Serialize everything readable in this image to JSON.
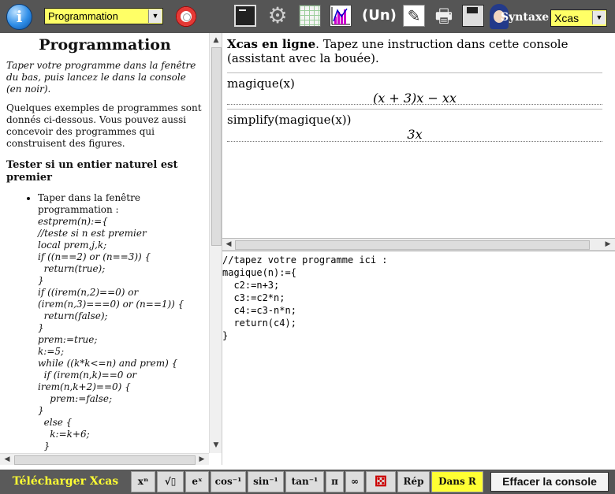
{
  "toolbar": {
    "info_glyph": "i",
    "mode_value": "Programmation",
    "sequence_label": "(Un)",
    "syntax_label": "Syntaxe",
    "syntax_value": "Xcas",
    "icons": [
      "info-icon",
      "lifebuoy-icon",
      "console-icon",
      "settings-icon",
      "spreadsheet-icon",
      "graph-icon",
      "sequence-icon",
      "pencil-icon",
      "printer-icon",
      "save-icon",
      "avatar-icon"
    ]
  },
  "left": {
    "title": "Programmation",
    "intro": "Taper votre programme dans la fenêtre du bas, puis lancez le dans la console (en noir).",
    "examples": "Quelques exemples de programmes sont donnés ci-dessous. Vous pouvez aussi concevoir des programmes qui construisent des figures.",
    "section_heading": "Tester si un entier naturel est premier",
    "list_item_text": "Taper dans la fenêtre programmation :",
    "code_lines": [
      "estprem(n):={",
      "//teste si n est premier",
      "local prem,j,k;",
      "if ((n==2) or (n==3)) {",
      "  return(true);",
      "}",
      "if ((irem(n,2)==0) or",
      "(irem(n,3)===0) or (n==1)) {",
      "  return(false);",
      "}",
      "prem:=true;",
      "k:=5;",
      "while ((k*k<=n) and prem) {",
      "  if (irem(n,k)==0 or",
      "irem(n,k+2)==0) {",
      "    prem:=false;",
      "}",
      "  else {",
      "    k:=k+6;",
      "  }"
    ]
  },
  "console": {
    "header_bold": "Xcas en ligne",
    "header_rest": ". Tapez une instruction dans cette console (assistant avec la bouée).",
    "entries": [
      {
        "command": "magique(x)",
        "result": "(x + 3)x − xx"
      },
      {
        "command": "simplify(magique(x))",
        "result": "3x"
      }
    ]
  },
  "editor": {
    "lines": [
      "//tapez votre programme ici :",
      "magique(n):={",
      "  c2:=n+3;",
      "  c3:=c2*n;",
      "  c4:=c3-n*n;",
      "  return(c4);",
      "}"
    ]
  },
  "bottom": {
    "download": "Télécharger Xcas",
    "keys": {
      "xn": "xⁿ",
      "sqrt": "√▯",
      "exp": "eˣ",
      "cos_inv": "cos⁻¹",
      "sin_inv": "sin⁻¹",
      "tan_inv": "tan⁻¹",
      "pi": "π",
      "inf": "∞",
      "dice": "⚄",
      "rep": "Rép",
      "dans_r": "Dans R",
      "clear": "Effacer la console"
    }
  }
}
